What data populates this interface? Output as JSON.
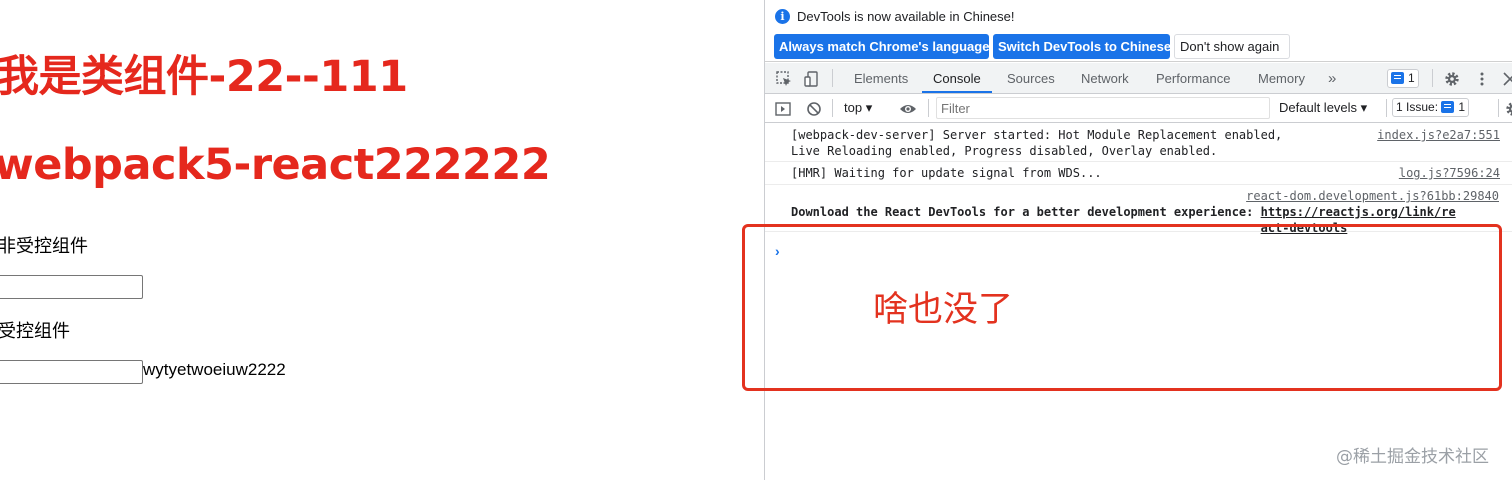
{
  "page": {
    "heading1": "我是类组件-22--111",
    "heading2": "webpack5-react222222",
    "label_uncontrolled": "非受控组件",
    "label_controlled": "受控组件",
    "uncontrolled_input_value": "",
    "controlled_input_value": "",
    "controlled_display_value": "wytyetwoeiuw2222"
  },
  "devtools": {
    "infobar": {
      "message": "DevTools is now available in Chinese!",
      "btn_match": "Always match Chrome's language",
      "btn_switch": "Switch DevTools to Chinese",
      "btn_dismiss": "Don't show again"
    },
    "tabs": [
      "Elements",
      "Console",
      "Sources",
      "Network",
      "Performance",
      "Memory"
    ],
    "active_tab": "Console",
    "more_tabs": "»",
    "message_count": "1",
    "toolbar": {
      "context": "top",
      "filter_placeholder": "Filter",
      "levels": "Default levels",
      "issues": "1 Issue:",
      "issue_count": "1"
    },
    "messages": [
      {
        "text": "[webpack-dev-server] Server started: Hot Module Replacement enabled,\nLive Reloading enabled, Progress disabled, Overlay enabled.",
        "source": "index.js?e2a7:551"
      },
      {
        "text": "[HMR] Waiting for update signal from WDS...",
        "source": "log.js?7596:24"
      },
      {
        "source": "react-dom.development.js?61bb:29840",
        "text": "Download the React DevTools for a better development experience: ",
        "link": "https://reactjs.org/link/react-devtools"
      }
    ],
    "prompt_symbol": "›"
  },
  "annotation": {
    "text": "啥也没了",
    "color": "#e3321f"
  },
  "watermark": "@稀土掘金技术社区",
  "colors": {
    "accent": "#1a73e8",
    "heading": "#e5281d"
  }
}
